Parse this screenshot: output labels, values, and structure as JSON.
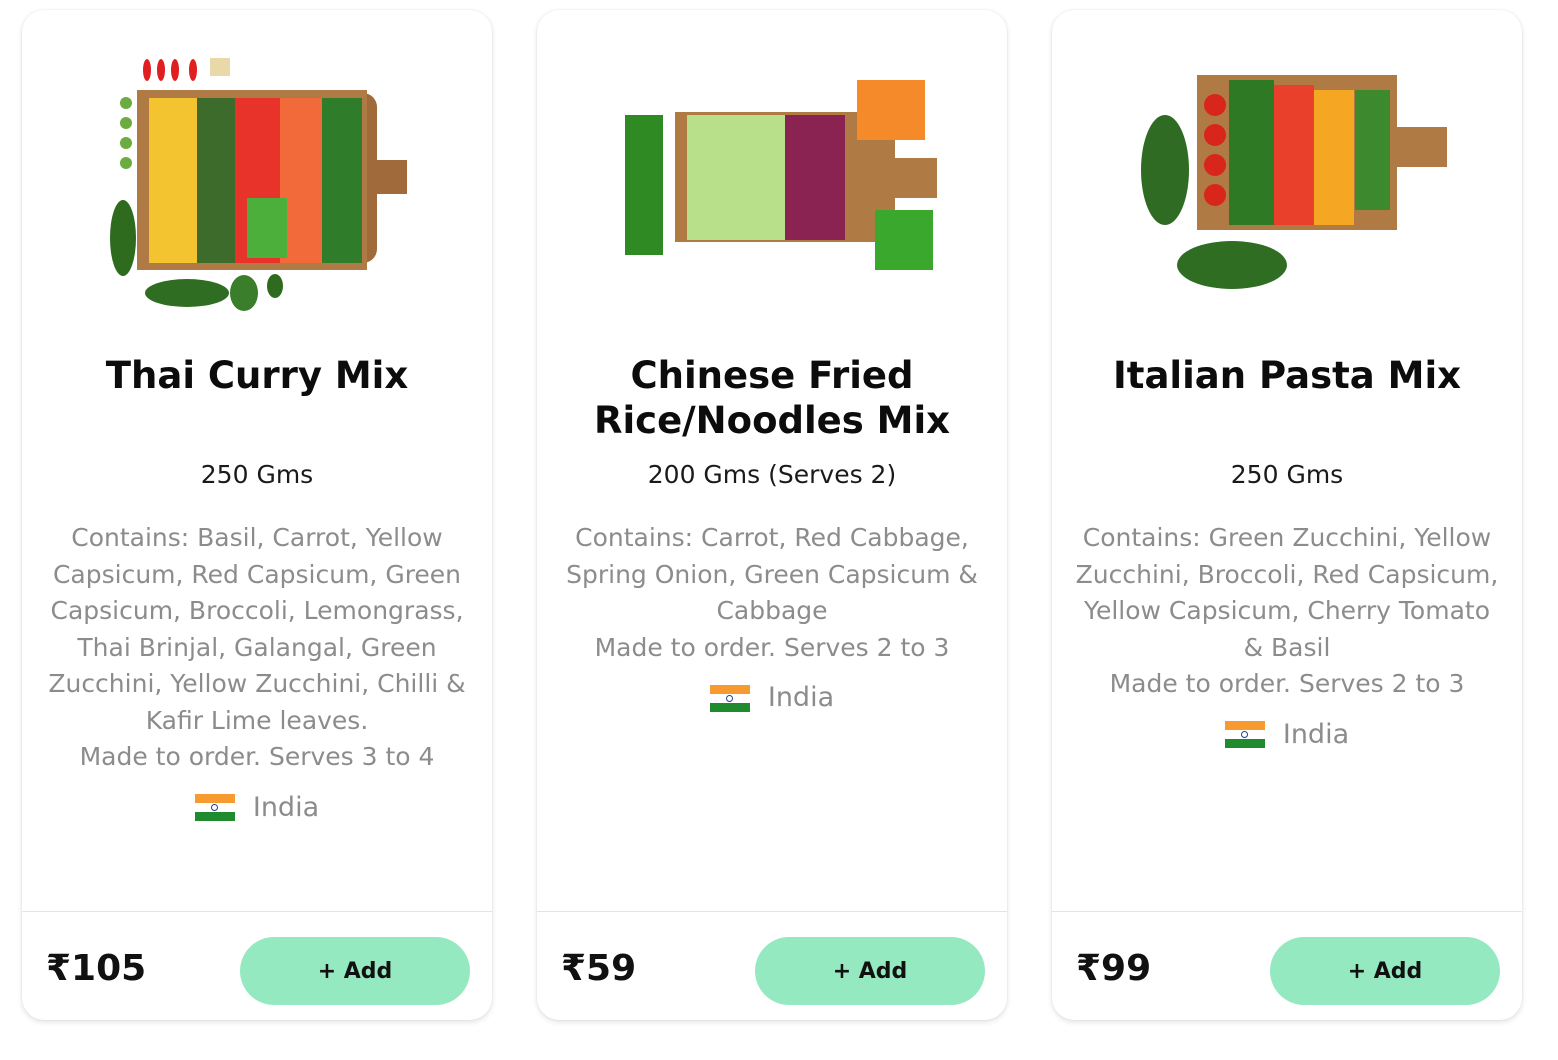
{
  "products": [
    {
      "title": "Thai Curry Mix",
      "weight": "250 Gms",
      "description": "Contains: Basil, Carrot, Yellow Capsicum, Red Capsicum, Green Capsicum, Broccoli, Lemongrass, Thai Brinjal, Galangal, Green Zucchini, Yellow Zucchini, Chilli & Kafir Lime leaves.",
      "serving_note": "Made to order. Serves 3 to 4",
      "origin": "India",
      "price": "₹105",
      "add_label": "+ Add"
    },
    {
      "title": "Chinese Fried Rice/Noodles Mix",
      "weight": "200 Gms (Serves 2)",
      "description": "Contains: Carrot, Red Cabbage, Spring Onion, Green Capsicum & Cabbage",
      "serving_note": "Made to order. Serves 2 to 3",
      "origin": "India",
      "price": "₹59",
      "add_label": "+ Add"
    },
    {
      "title": "Italian Pasta Mix",
      "weight": "250 Gms",
      "description": "Contains: Green Zucchini, Yellow Zucchini, Broccoli, Red Capsicum, Yellow Capsicum, Cherry Tomato & Basil",
      "serving_note": "Made to order. Serves 2 to 3",
      "origin": "India",
      "price": "₹99",
      "add_label": "+ Add"
    }
  ],
  "colors": {
    "add_button": "#95e9c1",
    "muted_text": "#8c8c8c",
    "divider": "#e4e4e4"
  },
  "icons": [
    "india-flag-icon"
  ]
}
